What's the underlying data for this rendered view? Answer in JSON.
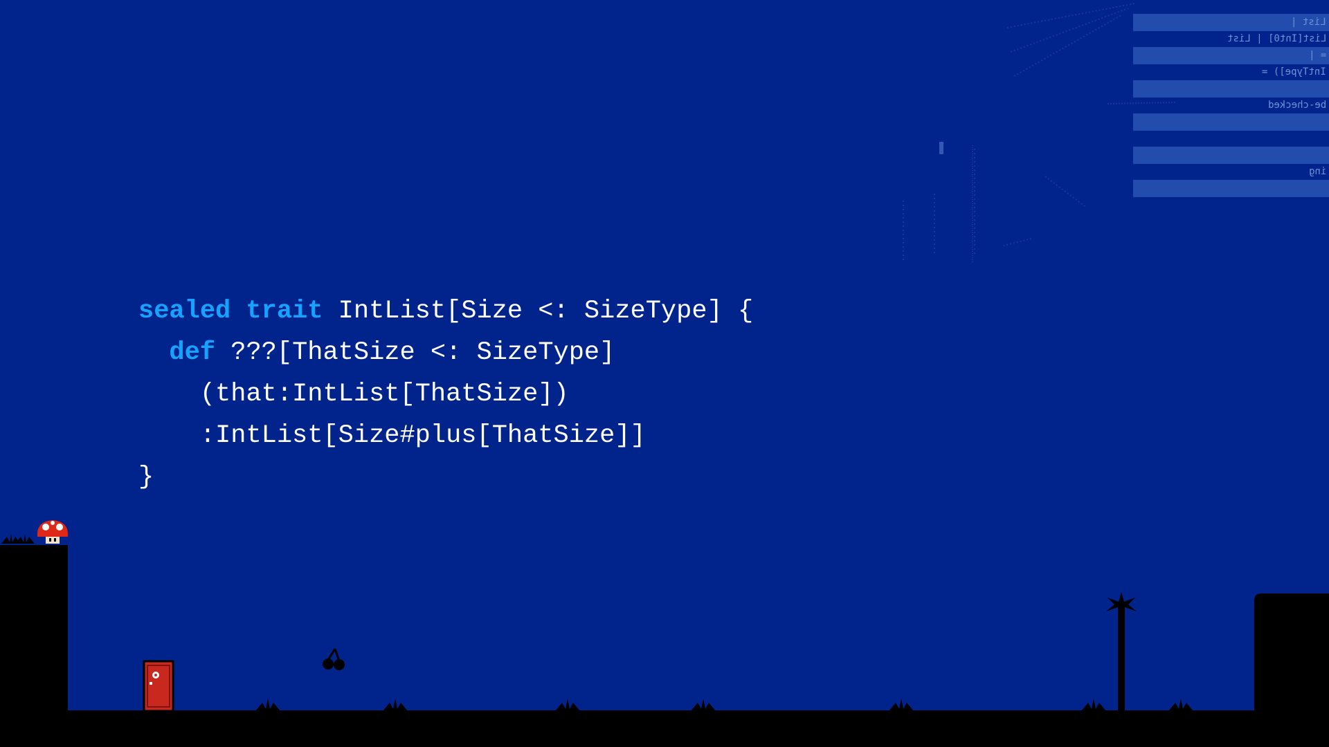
{
  "code": {
    "lines": [
      {
        "indent": "",
        "keyword": "sealed trait",
        "text": " IntList[Size <: SizeType] {"
      },
      {
        "indent": "  ",
        "keyword": "def",
        "text": " ???[ThatSize <: SizeType]"
      },
      {
        "indent": "    ",
        "keyword": "",
        "text": "(that:IntList[ThatSize])"
      },
      {
        "indent": "    ",
        "keyword": "",
        "text": ":IntList[Size#plus[ThatSize]]"
      },
      {
        "indent": "",
        "keyword": "",
        "text": "}"
      }
    ]
  },
  "ghost": {
    "lines": [
      "List |",
      "List[Int0] | List",
      "= |",
      "IntType]) =",
      "be-checked",
      "ing"
    ]
  },
  "colors": {
    "background": "#00248b",
    "keyword": "#15a3ff",
    "code_text": "#ffffff",
    "ground": "#000000",
    "door": "#c8281e",
    "mushroom_cap": "#e02818"
  },
  "icons": [
    "mushroom-icon",
    "door-icon",
    "cherry-icon",
    "palm-tree-icon",
    "grass-tuft-icon"
  ]
}
